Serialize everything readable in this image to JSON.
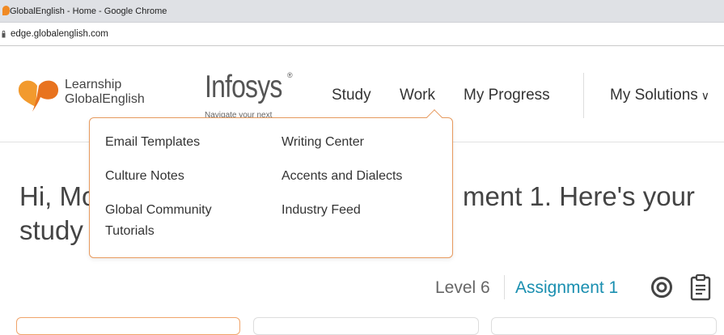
{
  "browser": {
    "window_title": "GlobalEnglish - Home - Google Chrome",
    "url": "edge.globalenglish.com"
  },
  "brand": {
    "line1": "Learnship",
    "line2": "GlobalEnglish",
    "partner_logo": "Infosys",
    "partner_reg": "®",
    "partner_tagline": "Navigate your next"
  },
  "nav": {
    "study": "Study",
    "work": "Work",
    "my_progress": "My Progress",
    "my_solutions": "My Solutions",
    "chevron": "∨"
  },
  "dropdown": {
    "email_templates": "Email Templates",
    "writing_center": "Writing Center",
    "culture_notes": "Culture Notes",
    "accents_dialects": "Accents and Dialects",
    "global_community_tutorials": "Global Community Tutorials",
    "industry_feed": "Industry Feed"
  },
  "main": {
    "greeting_left_line1": "Hi, Mo",
    "greeting_left_line2": "study",
    "greeting_right": "ment 1. Here's your",
    "level": "Level 6",
    "assignment": "Assignment 1"
  },
  "colors": {
    "accent_orange": "#f08a24",
    "assignment_blue": "#1a8fb0",
    "dropdown_border": "#e79a5e"
  },
  "icons": {
    "target": "target-icon",
    "clipboard": "clipboard-icon",
    "lock": "lock-icon"
  }
}
